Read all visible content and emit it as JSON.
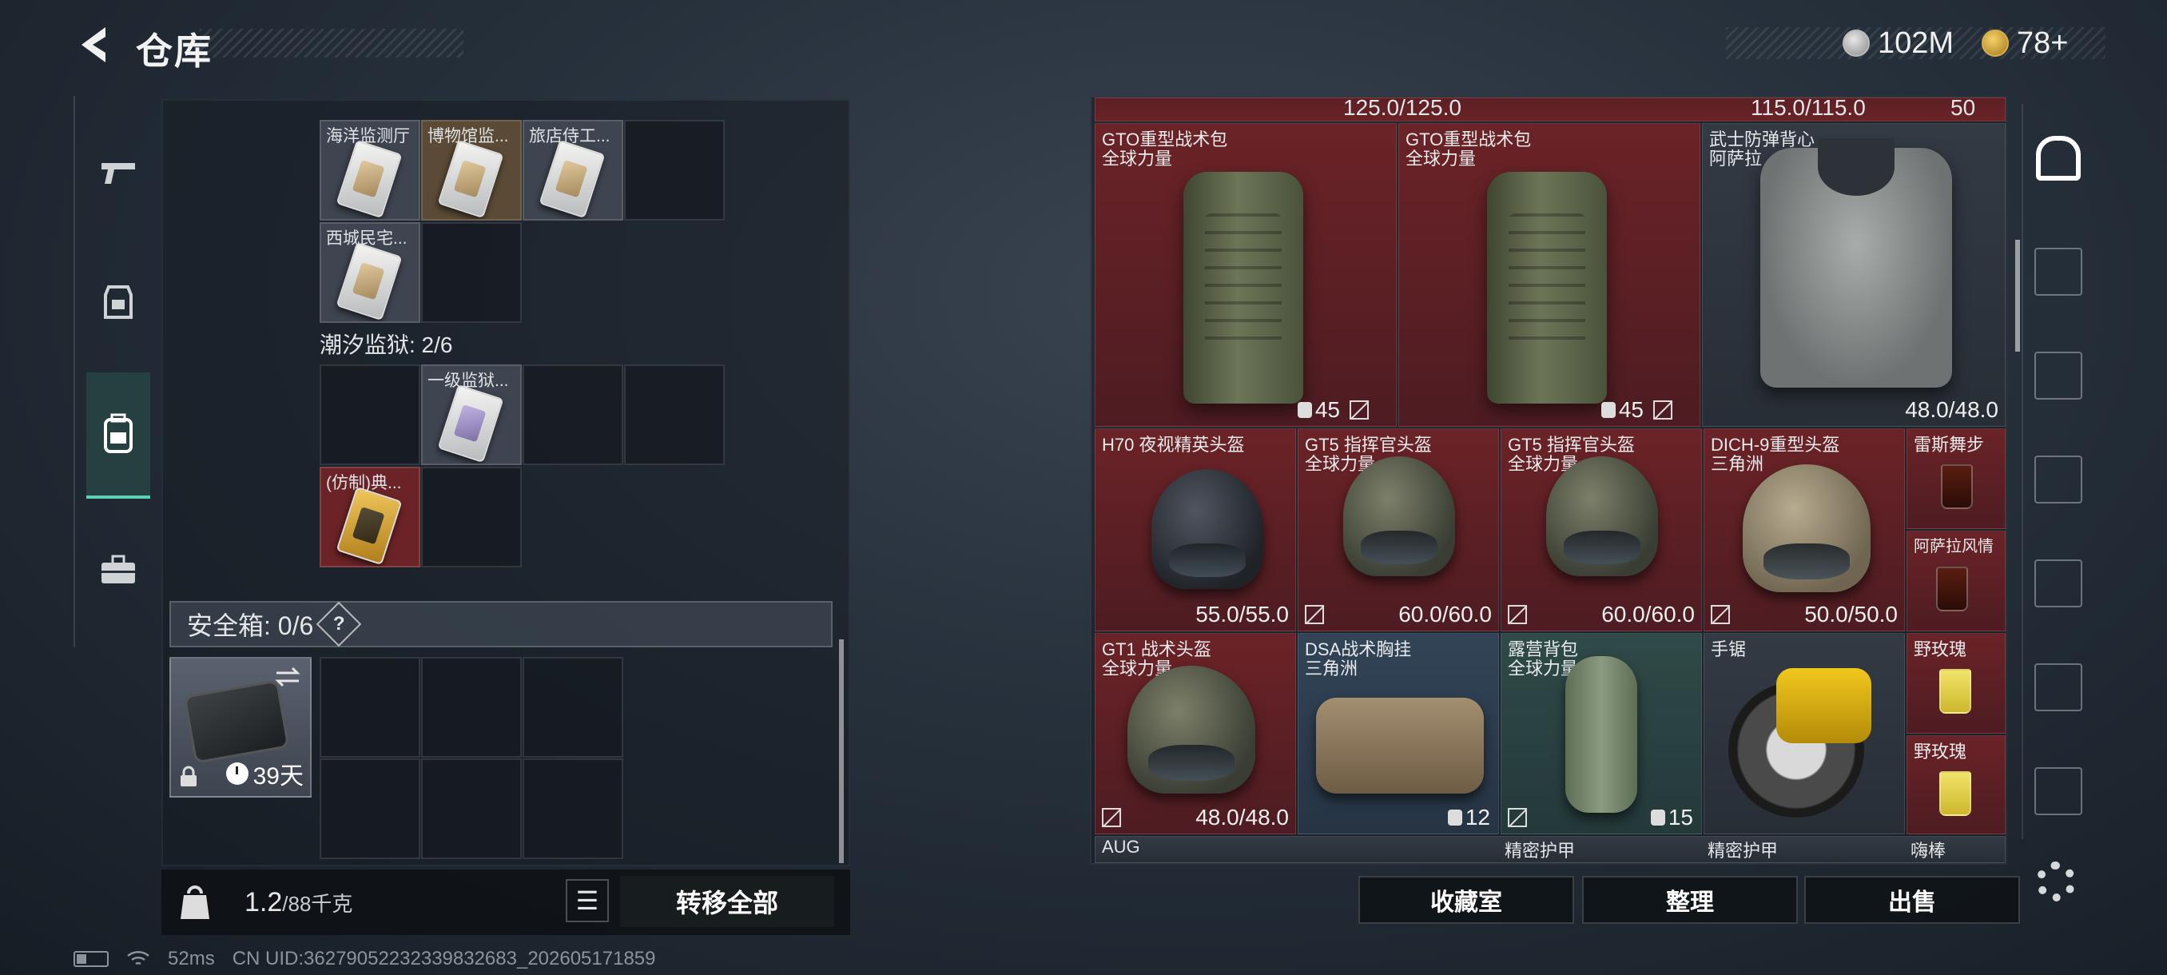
{
  "header": {
    "title": "仓库"
  },
  "currency": {
    "silver": "102M",
    "gold": "78+"
  },
  "left_nav": {
    "items": [
      "weapons",
      "armor",
      "backpack",
      "toolbox"
    ]
  },
  "storage": {
    "row1_items": [
      "海洋监测厅",
      "博物馆监...",
      "旅店侍工..."
    ],
    "row2_items": [
      "西城民宅..."
    ],
    "prison_label": "潮汐监狱: 2/6",
    "prison_items": [
      "一级监狱...",
      "(仿制)典..."
    ],
    "safe_box_label": "安全箱: 0/6",
    "help_label": "?",
    "case_days": "39天"
  },
  "weight": {
    "current": "1.2",
    "max": "/88千克"
  },
  "buttons": {
    "transfer_all": "转移全部",
    "collection": "收藏室",
    "organize": "整理",
    "sell": "出售",
    "list_icon": "☰"
  },
  "inventory": {
    "top_partial": [
      "125.0/125.0",
      "115.0/115.0",
      "50"
    ],
    "cells": [
      {
        "n1": "GTO重型战术包",
        "n2": "全球力量",
        "cap": "45"
      },
      {
        "n1": "GTO重型战术包",
        "n2": "全球力量",
        "cap": "45"
      },
      {
        "n1": "武士防弹背心",
        "n2": "阿萨拉",
        "dur": "48.0/48.0"
      },
      {
        "n1": "H70 夜视精英头盔",
        "n2": "",
        "dur": "55.0/55.0"
      },
      {
        "n1": "GT5 指挥官头盔",
        "n2": "全球力量",
        "dur": "60.0/60.0"
      },
      {
        "n1": "GT5 指挥官头盔",
        "n2": "全球力量",
        "dur": "60.0/60.0"
      },
      {
        "n1": "DICH-9重型头盔",
        "n2": "三角洲",
        "dur": "50.0/50.0"
      },
      {
        "n1": "雷斯舞步",
        "n2": ""
      },
      {
        "n1": "阿萨拉风情",
        "n2": ""
      },
      {
        "n1": "GT1 战术头盔",
        "n2": "全球力量",
        "dur": "48.0/48.0"
      },
      {
        "n1": "DSA战术胸挂",
        "n2": "三角洲",
        "cap": "12"
      },
      {
        "n1": "露营背包",
        "n2": "全球力量",
        "cap": "15"
      },
      {
        "n1": "手锯",
        "n2": ""
      },
      {
        "n1": "野玫瑰",
        "n2": ""
      },
      {
        "n1": "野玫瑰",
        "n2": ""
      }
    ],
    "bottom_partial": [
      "AUG",
      "精密护甲",
      "精密护甲",
      "嗨棒"
    ]
  },
  "status": {
    "ping": "52ms",
    "uid": "CN UID:36279052232339832683_202605171859"
  },
  "colors": {
    "accent": "#5fd0b5",
    "rarity_red": "#6b2327",
    "rarity_blue": "#324457"
  }
}
